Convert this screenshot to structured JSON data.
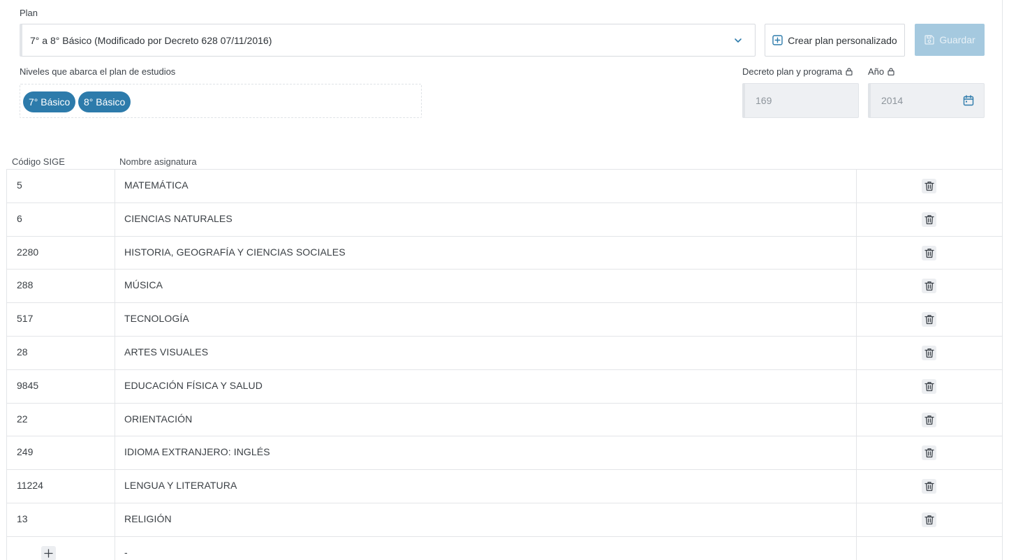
{
  "plan": {
    "label": "Plan",
    "selected": "7° a 8° Básico (Modificado por Decreto 628 07/11/2016)"
  },
  "toolbar": {
    "create_label": "Crear plan personalizado",
    "save_label": "Guardar"
  },
  "levels": {
    "label": "Niveles que abarca el plan de estudios",
    "tags": [
      "7° Básico",
      "8° Básico"
    ]
  },
  "decree": {
    "label": "Decreto plan y programa",
    "value": "169"
  },
  "year": {
    "label": "Año",
    "value": "2014"
  },
  "table": {
    "headers": {
      "code": "Código SIGE",
      "name": "Nombre asignatura"
    },
    "rows": [
      {
        "code": "5",
        "name": "MATEMÁTICA"
      },
      {
        "code": "6",
        "name": "CIENCIAS NATURALES"
      },
      {
        "code": "2280",
        "name": "HISTORIA, GEOGRAFÍA Y CIENCIAS SOCIALES"
      },
      {
        "code": "288",
        "name": "MÚSICA"
      },
      {
        "code": "517",
        "name": "TECNOLOGÍA"
      },
      {
        "code": "28",
        "name": "ARTES VISUALES"
      },
      {
        "code": "9845",
        "name": "EDUCACIÓN FÍSICA Y SALUD"
      },
      {
        "code": "22",
        "name": "ORIENTACIÓN"
      },
      {
        "code": "249",
        "name": "IDIOMA EXTRANJERO: INGLÉS"
      },
      {
        "code": "11224",
        "name": "LENGUA Y LITERATURA"
      },
      {
        "code": "13",
        "name": "RELIGIÓN"
      }
    ],
    "new_row_name": "-"
  },
  "colors": {
    "accent": "#2d7bab",
    "save_disabled": "#a5c9df"
  }
}
